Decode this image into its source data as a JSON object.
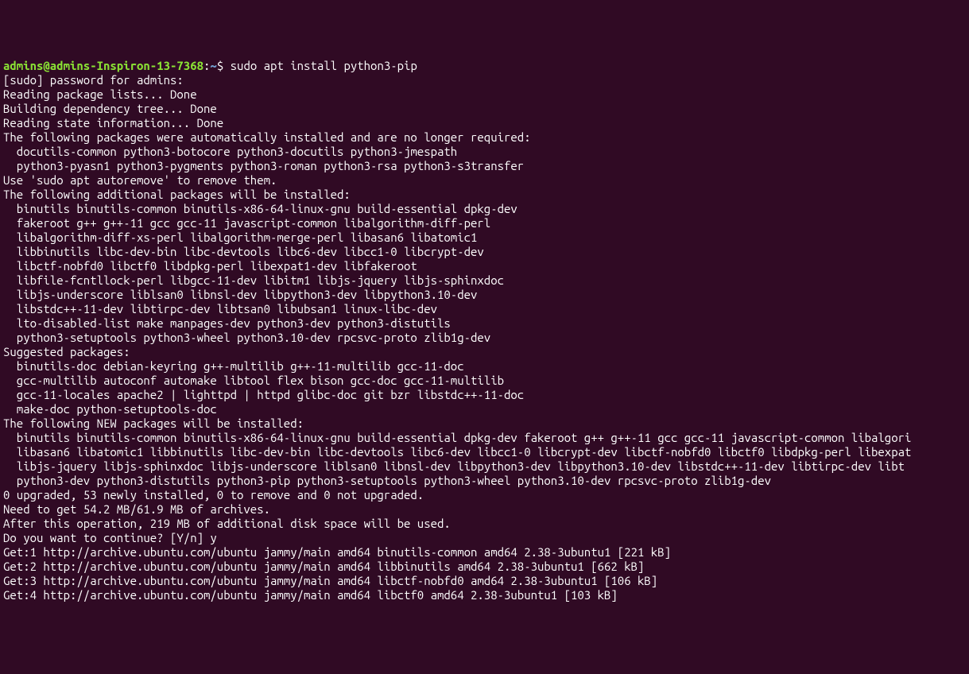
{
  "prompt": {
    "user_host": "admins@admins-Inspiron-13-7368",
    "separator": ":",
    "path": "~",
    "dollar": "$ ",
    "command": "sudo apt install python3-pip"
  },
  "lines": [
    "[sudo] password for admins: ",
    "Reading package lists... Done",
    "Building dependency tree... Done",
    "Reading state information... Done",
    "The following packages were automatically installed and are no longer required:",
    "  docutils-common python3-botocore python3-docutils python3-jmespath",
    "  python3-pyasn1 python3-pygments python3-roman python3-rsa python3-s3transfer",
    "Use 'sudo apt autoremove' to remove them.",
    "The following additional packages will be installed:",
    "  binutils binutils-common binutils-x86-64-linux-gnu build-essential dpkg-dev",
    "  fakeroot g++ g++-11 gcc gcc-11 javascript-common libalgorithm-diff-perl",
    "  libalgorithm-diff-xs-perl libalgorithm-merge-perl libasan6 libatomic1",
    "  libbinutils libc-dev-bin libc-devtools libc6-dev libcc1-0 libcrypt-dev",
    "  libctf-nobfd0 libctf0 libdpkg-perl libexpat1-dev libfakeroot",
    "  libfile-fcntllock-perl libgcc-11-dev libitm1 libjs-jquery libjs-sphinxdoc",
    "  libjs-underscore liblsan0 libnsl-dev libpython3-dev libpython3.10-dev",
    "  libstdc++-11-dev libtirpc-dev libtsan0 libubsan1 linux-libc-dev",
    "  lto-disabled-list make manpages-dev python3-dev python3-distutils",
    "  python3-setuptools python3-wheel python3.10-dev rpcsvc-proto zlib1g-dev",
    "Suggested packages:",
    "  binutils-doc debian-keyring g++-multilib g++-11-multilib gcc-11-doc",
    "  gcc-multilib autoconf automake libtool flex bison gcc-doc gcc-11-multilib",
    "  gcc-11-locales apache2 | lighttpd | httpd glibc-doc git bzr libstdc++-11-doc",
    "  make-doc python-setuptools-doc",
    "The following NEW packages will be installed:",
    "  binutils binutils-common binutils-x86-64-linux-gnu build-essential dpkg-dev fakeroot g++ g++-11 gcc gcc-11 javascript-common libalgori",
    "  libasan6 libatomic1 libbinutils libc-dev-bin libc-devtools libc6-dev libcc1-0 libcrypt-dev libctf-nobfd0 libctf0 libdpkg-perl libexpat",
    "  libjs-jquery libjs-sphinxdoc libjs-underscore liblsan0 libnsl-dev libpython3-dev libpython3.10-dev libstdc++-11-dev libtirpc-dev libt",
    "  python3-dev python3-distutils python3-pip python3-setuptools python3-wheel python3.10-dev rpcsvc-proto zlib1g-dev",
    "0 upgraded, 53 newly installed, 0 to remove and 0 not upgraded.",
    "Need to get 54.2 MB/61.9 MB of archives.",
    "After this operation, 219 MB of additional disk space will be used.",
    "Do you want to continue? [Y/n] y",
    "Get:1 http://archive.ubuntu.com/ubuntu jammy/main amd64 binutils-common amd64 2.38-3ubuntu1 [221 kB]",
    "Get:2 http://archive.ubuntu.com/ubuntu jammy/main amd64 libbinutils amd64 2.38-3ubuntu1 [662 kB]",
    "Get:3 http://archive.ubuntu.com/ubuntu jammy/main amd64 libctf-nobfd0 amd64 2.38-3ubuntu1 [106 kB]",
    "Get:4 http://archive.ubuntu.com/ubuntu jammy/main amd64 libctf0 amd64 2.38-3ubuntu1 [103 kB]"
  ]
}
